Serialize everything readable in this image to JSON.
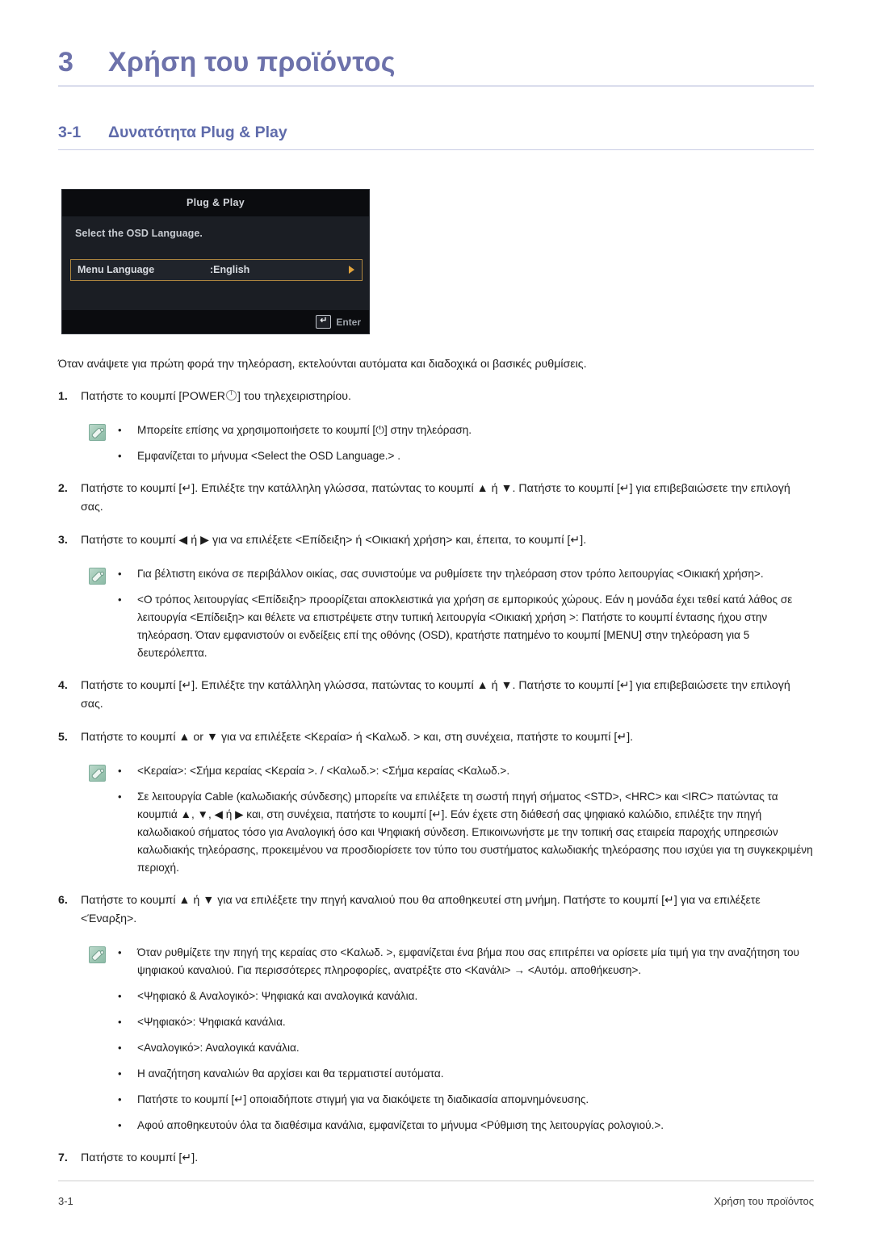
{
  "chapter": {
    "number": "3",
    "title": "Χρήση του προϊόντος"
  },
  "section": {
    "number": "3-1",
    "title": "Δυνατότητα Plug & Play"
  },
  "osd": {
    "title": "Plug & Play",
    "prompt": "Select the OSD Language.",
    "row_label": "Menu Language",
    "row_value": ":English",
    "enter_label": "Enter",
    "enter_key_glyph": "↵",
    "arrow_icon": "right-arrow-icon",
    "border_color": "#b0873f",
    "background_color": "#15171c"
  },
  "lead": "Όταν ανάψετε για πρώτη φορά την τηλεόραση, εκτελούνται αυτόματα και διαδοχικά οι βασικές ρυθμίσεις.",
  "steps": [
    {
      "num": "1.",
      "text_before": "Πατήστε το κουμπί [POWER",
      "icon": "power-icon",
      "text_after": "] του τηλεχειριστηρίου."
    },
    {
      "num": "2.",
      "text": "Πατήστε το κουμπί [↵]. Επιλέξτε την κατάλληλη γλώσσα, πατώντας το κουμπί ▲ ή ▼. Πατήστε το κουμπί [↵] για επιβεβαιώσετε την επιλογή σας."
    },
    {
      "num": "3.",
      "text": "Πατήστε το κουμπί ◀ ή ▶ για να επιλέξετε <Επίδειξη> ή <Οικιακή χρήση> και, έπειτα, το κουμπί [↵]."
    },
    {
      "num": "4.",
      "text": "Πατήστε το κουμπί [↵]. Επιλέξτε την κατάλληλη γλώσσα, πατώντας το κουμπί ▲ ή ▼. Πατήστε το κουμπί [↵] για επιβεβαιώσετε την επιλογή σας."
    },
    {
      "num": "5.",
      "text": "Πατήστε το κουμπί ▲ or ▼ για να επιλέξετε <Κεραία> ή <Καλωδ. > και, στη συνέχεια, πατήστε το κουμπί [↵]."
    },
    {
      "num": "6.",
      "text": "Πατήστε το κουμπί ▲ ή ▼ για να επιλέξετε την πηγή καναλιού που θα αποθηκευτεί στη μνήμη. Πατήστε το κουμπί [↵] για να επιλέξετε <Έναρξη>."
    },
    {
      "num": "7.",
      "text": "Πατήστε το κουμπί [↵]."
    }
  ],
  "note_groups": {
    "after_step1": [
      "Μπορείτε επίσης να χρησιμοποιήσετε το κουμπί [⏻] στην τηλεόραση.",
      "Εμφανίζεται το μήνυμα <Select the OSD Language.> ."
    ],
    "after_step3": [
      "Για βέλτιστη εικόνα σε περιβάλλον οικίας, σας συνιστούμε να ρυθμίσετε την τηλεόραση στον τρόπο λειτουργίας <Οικιακή χρήση>.",
      "<Ο τρόπος λειτουργίας <Επίδειξη> προορίζεται αποκλειστικά για χρήση σε εμπορικούς χώρους. Εάν η μονάδα έχει τεθεί κατά λάθος σε λειτουργία <Επίδειξη> και θέλετε να επιστρέψετε στην τυπική λειτουργία <Οικιακή χρήση >: Πατήστε το κουμπί έντασης ήχου στην τηλεόραση. Όταν εμφανιστούν οι ενδείξεις επί της οθόνης (OSD), κρατήστε πατημένο το κουμπί [MENU] στην τηλεόραση για 5 δευτερόλεπτα."
    ],
    "after_step5": [
      "<Κεραία>: <Σήμα κεραίας <Κεραία >. / <Καλωδ.>: <Σήμα κεραίας <Καλωδ.>.",
      "Σε λειτουργία Cable (καλωδιακής σύνδεσης) μπορείτε να επιλέξετε τη σωστή πηγή σήματος <STD>, <HRC> και <IRC> πατώντας τα κουμπιά ▲, ▼, ◀ ή ▶ και, στη συνέχεια, πατήστε το κουμπί [↵]. Εάν έχετε στη διάθεσή σας ψηφιακό καλώδιο, επιλέξτε την πηγή καλωδιακού σήματος τόσο για Αναλογική όσο και Ψηφιακή σύνδεση. Επικοινωνήστε με την τοπική σας εταιρεία παροχής υπηρεσιών καλωδιακής τηλεόρασης, προκειμένου να προσδιορίσετε τον τύπο του συστήματος καλωδιακής τηλεόρασης που ισχύει για τη συγκεκριμένη περιοχή."
    ],
    "after_step6": [
      "Όταν ρυθμίζετε την πηγή της κεραίας στο <Καλωδ. >, εμφανίζεται ένα βήμα που σας επιτρέπει να ορίσετε μία τιμή για την αναζήτηση του ψηφιακού καναλιού. Για περισσότερες πληροφορίες, ανατρέξτε στο <Κανάλι> → <Αυτόμ. αποθήκευση>.",
      "<Ψηφιακό & Αναλογικό>: Ψηφιακά και αναλογικά κανάλια.",
      "<Ψηφιακό>: Ψηφιακά κανάλια.",
      "<Αναλογικό>: Αναλογικά κανάλια.",
      "Η αναζήτηση καναλιών θα αρχίσει και θα τερματιστεί αυτόματα.",
      "Πατήστε το κουμπί [↵] οποιαδήποτε στιγμή για να διακόψετε τη διαδικασία απομνημόνευσης.",
      "Αφού αποθηκευτούν όλα τα διαθέσιμα κανάλια, εμφανίζεται το μήνυμα <Ρύθμιση της λειτουργίας ρολογιού.>."
    ]
  },
  "bullet_glyph": "•",
  "footer": {
    "page_number": "3-1",
    "chapter_name": "Χρήση του προϊόντος"
  },
  "colors": {
    "heading": "#6d72ab",
    "section_heading": "#5f6bab",
    "note_icon": "#9ec7b4",
    "osd_highlight": "#b0873f"
  }
}
